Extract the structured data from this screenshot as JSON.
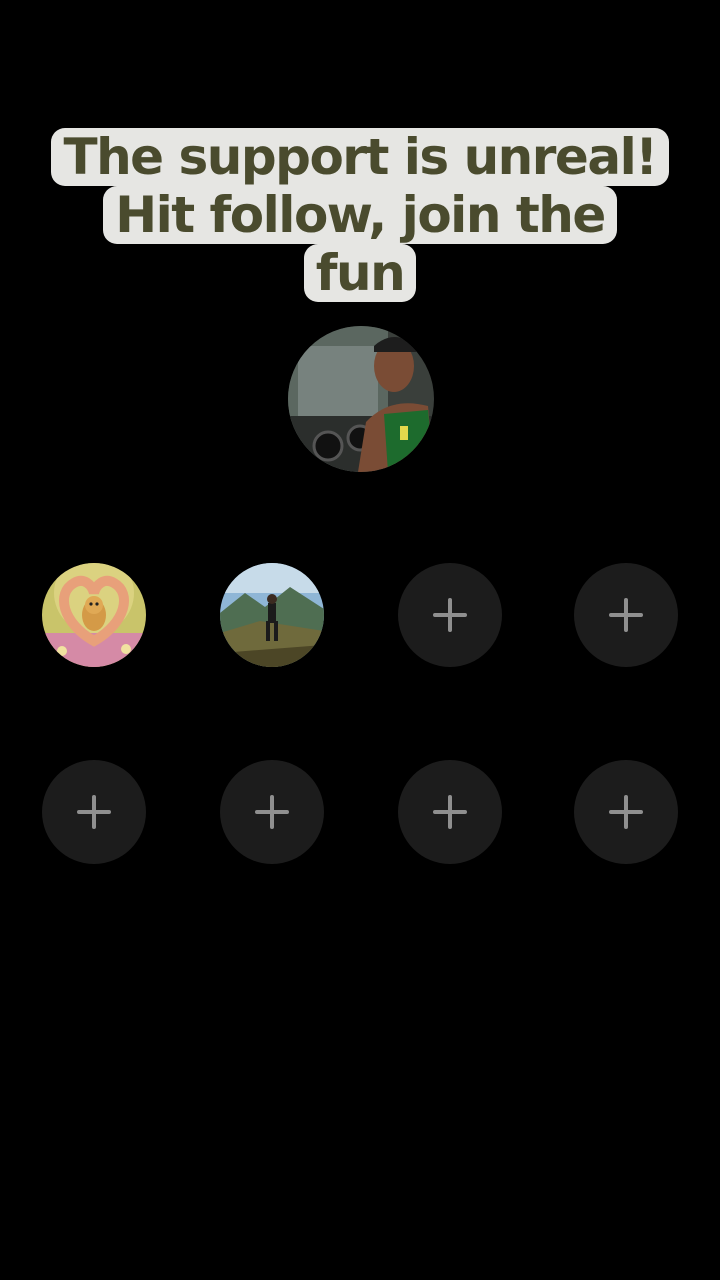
{
  "caption": {
    "lines": [
      "The support is unreal!",
      "Hit follow, join the",
      "fun"
    ]
  },
  "host": {
    "avatar_icon": "host-avatar-photo"
  },
  "slots": [
    {
      "type": "avatar",
      "icon": "heart-hands-dog-avatar"
    },
    {
      "type": "avatar",
      "icon": "mountain-hiker-avatar"
    },
    {
      "type": "empty",
      "icon": "plus-icon"
    },
    {
      "type": "empty",
      "icon": "plus-icon"
    },
    {
      "type": "empty",
      "icon": "plus-icon"
    },
    {
      "type": "empty",
      "icon": "plus-icon"
    },
    {
      "type": "empty",
      "icon": "plus-icon"
    },
    {
      "type": "empty",
      "icon": "plus-icon"
    }
  ],
  "colors": {
    "background": "#000000",
    "caption_bg": "#e6e6e3",
    "caption_text": "#4a4b2e",
    "slot_bg": "#1c1c1c",
    "plus": "#8f8f8f"
  }
}
